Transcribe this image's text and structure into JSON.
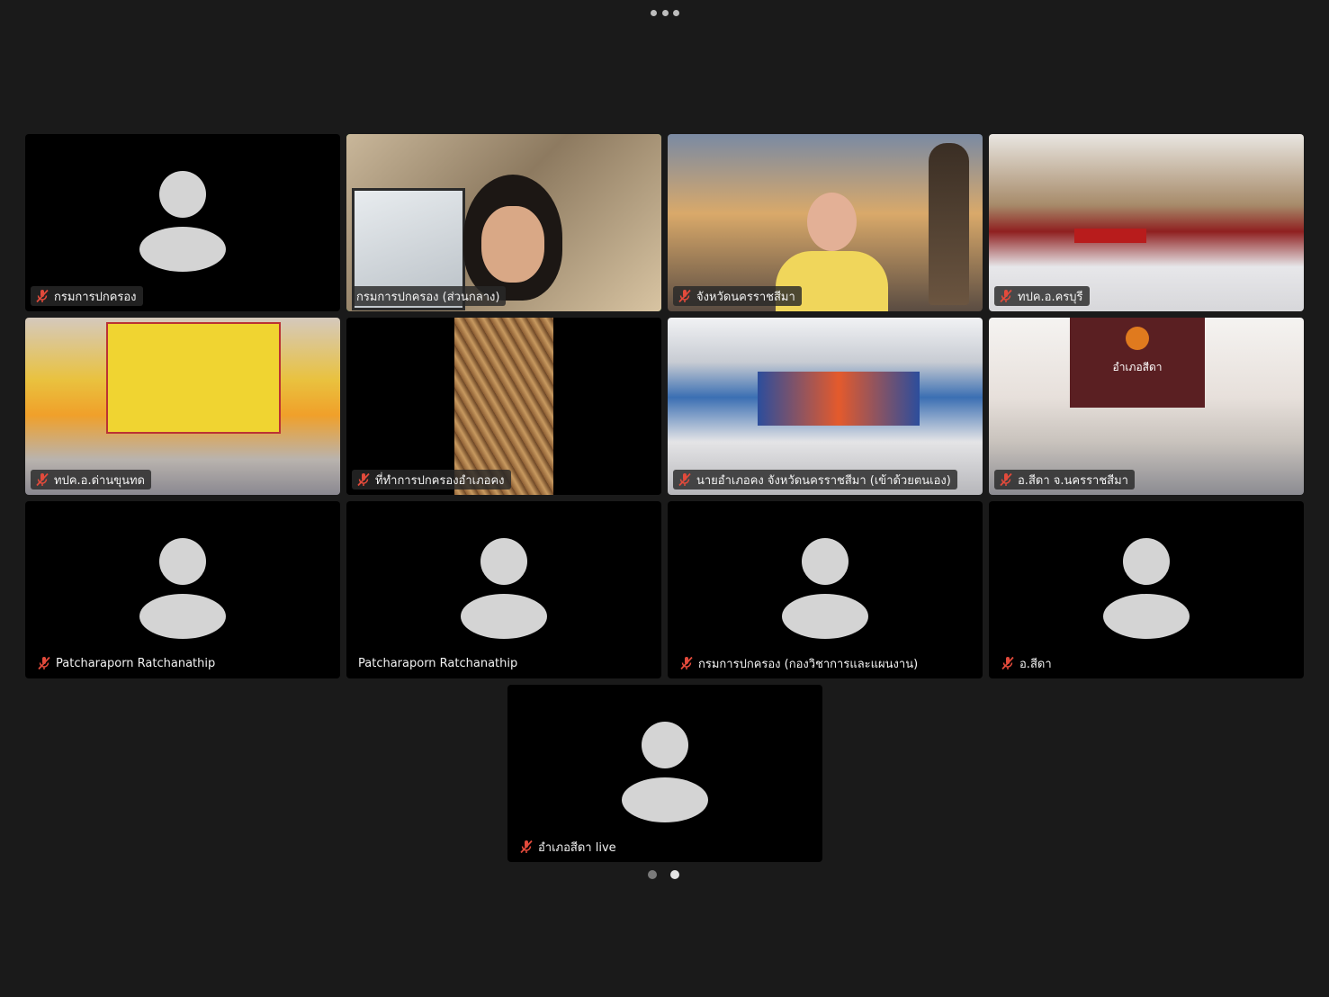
{
  "app": {
    "accent_color": "#3ec84a",
    "muted_mic_color": "#e24a3b"
  },
  "participants": [
    {
      "name": "กรมการปกครอง",
      "muted": true,
      "video": "off"
    },
    {
      "name": "กรมการปกครอง (ส่วนกลาง)",
      "muted": false,
      "video": "on",
      "active_speaker": true
    },
    {
      "name": "จังหวัดนครราชสีมา",
      "muted": true,
      "video": "on"
    },
    {
      "name": "ทปค.อ.ครบุรี",
      "muted": true,
      "video": "on"
    },
    {
      "name": "ทปค.อ.ด่านขุนทด",
      "muted": true,
      "video": "on"
    },
    {
      "name": "ที่ทำการปกครองอำเภอคง",
      "muted": true,
      "video": "on"
    },
    {
      "name": "นายอำเภอคง จังหวัดนครราชสีมา (เข้าด้วยตนเอง)",
      "muted": true,
      "video": "on"
    },
    {
      "name": "อ.สีดา จ.นครราชสีมา",
      "muted": true,
      "video": "on"
    },
    {
      "name": "Patcharaporn Ratchanathip",
      "muted": true,
      "video": "off"
    },
    {
      "name": "Patcharaporn Ratchanathip",
      "muted": false,
      "video": "off"
    },
    {
      "name": "กรมการปกครอง (กองวิชาการและแผนงาน)",
      "muted": true,
      "video": "off"
    },
    {
      "name": "อ.สีดา",
      "muted": true,
      "video": "off"
    },
    {
      "name": "อำเภอสีดา live",
      "muted": true,
      "video": "off"
    }
  ],
  "video_text": {
    "sida_board": "อำเภอสีดา"
  },
  "pagination": {
    "pages": 2,
    "current": 2
  }
}
